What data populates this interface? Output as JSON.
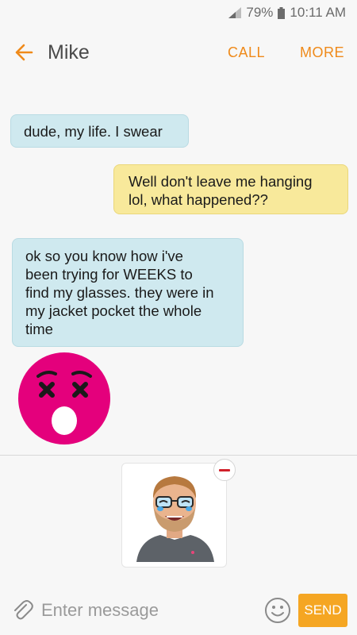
{
  "status_bar": {
    "battery": "79%",
    "time": "10:11 AM",
    "icons": [
      "signal-icon",
      "battery-icon"
    ]
  },
  "header": {
    "back_icon": "arrow-left-icon",
    "contact_name": "Mike",
    "call_label": "CALL",
    "more_label": "MORE",
    "accent_color": "#ef8a1a"
  },
  "messages": [
    {
      "direction": "incoming",
      "text": "dude, my life. I swear"
    },
    {
      "direction": "outgoing",
      "lines": [
        "Well don't leave me hanging",
        "lol, what happened??"
      ]
    },
    {
      "direction": "incoming",
      "lines": [
        "ok so you know how i've",
        "been trying for WEEKS to",
        "find my glasses. they were in",
        "my jacket pocket the whole",
        "time"
      ]
    },
    {
      "direction": "incoming",
      "type": "sticker",
      "sticker": "dizzy-face-emoji-icon",
      "color": "#e4007c"
    }
  ],
  "attachment": {
    "type": "bitmoji-avatar",
    "icon": "avatar-sticker-icon",
    "remove_icon": "minus-circle-icon"
  },
  "composer": {
    "attach_icon": "paperclip-icon",
    "placeholder": "Enter message",
    "emoji_icon": "smiley-icon",
    "send_label": "SEND",
    "send_color": "#f5a623"
  }
}
